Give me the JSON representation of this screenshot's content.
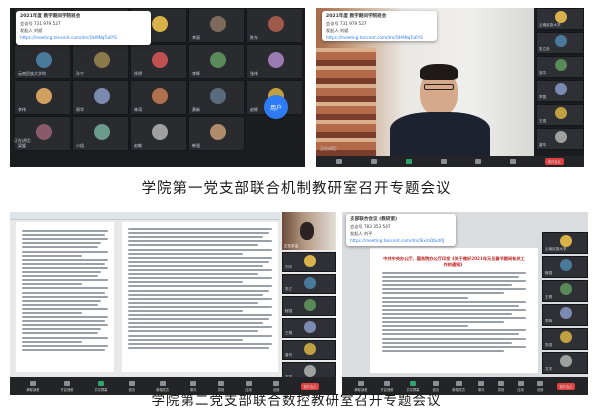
{
  "captions": {
    "top": "学院第一党支部联合机制教研室召开专题会议",
    "bottom": "学院第二党支部联合数控教研室召开专题会议"
  },
  "colors": {
    "dark_bg": "#1b1c1f",
    "toolbar": "#232428",
    "leave_red": "#e04040",
    "accent_blue": "#2d7cf6",
    "purple": "#5b6be0"
  },
  "meetings": {
    "tl": {
      "popup": {
        "title": "2021年度 教学期间学院班会",
        "line1": "会议号 731 979 527",
        "line2": "发起人 刘斌",
        "line3": "https://meeting.tencent.com/dm/OH9NqTu6YS"
      },
      "tiles": [
        {
          "name": "王海"
        },
        {
          "name": "赵强讲生"
        },
        {
          "name": "刘洪"
        },
        {
          "name": "李丽"
        },
        {
          "name": "陈东"
        },
        {
          "name": "云南民族大学的"
        },
        {
          "name": "孙宁"
        },
        {
          "name": "徐明"
        },
        {
          "name": "李辉"
        },
        {
          "name": "张伟"
        },
        {
          "name": "李伟"
        },
        {
          "name": "周华"
        },
        {
          "name": "林涛"
        },
        {
          "name": "黄新"
        },
        {
          "name": "赵辉"
        },
        {
          "name": "梁媛"
        },
        {
          "name": "小组"
        },
        {
          "name": "赵敏"
        },
        {
          "name": "韩强"
        },
        {
          "name": "小程序用户"
        }
      ],
      "avatar_user_label": "用户",
      "speaking_label": "正在讲话:"
    },
    "tr": {
      "popup": {
        "title": "2021年度 教学期间学院班会",
        "line1": "会议号 731 979 527",
        "line2": "发起人 刘斌",
        "line3": "https://meeting.tencent.com/dm/OH9NqTu6YS"
      },
      "side": [
        {
          "name": "云南民族大学"
        },
        {
          "name": "张立忠"
        },
        {
          "name": "邹平"
        },
        {
          "name": "李国"
        },
        {
          "name": "王强"
        },
        {
          "name": "曾华"
        }
      ],
      "speaking_label": "正在讲话:",
      "leave_label": "离开会议"
    },
    "bl": {
      "status_label": "正在讲话",
      "side": [
        {
          "name": "刘平"
        },
        {
          "name": "张江"
        },
        {
          "name": "程强"
        },
        {
          "name": "王刚"
        },
        {
          "name": "曾玲"
        },
        {
          "name": "文宇"
        }
      ],
      "leave_label": "离开会议",
      "toolbar": [
        "解除静音",
        "开启视频",
        "共享屏幕",
        "邀请",
        "管理成员",
        "聊天",
        "录制",
        "应用",
        "设置"
      ]
    },
    "br": {
      "popup": {
        "title": "支部联合会议 (教研室)",
        "line1": "会议号 783 353 547",
        "line2": "发起人 刘平",
        "line3": "https://meeting.tencent.com/dm/SlxmQ6ut0J"
      },
      "doc_title": "中共中央办公厅、国务院办公厅印发《关于做好2021年元旦春节期间有关工作的通知》",
      "side": [
        {
          "name": "云南民族大学"
        },
        {
          "name": "程强"
        },
        {
          "name": "王刚"
        },
        {
          "name": "李辉"
        },
        {
          "name": "张强"
        },
        {
          "name": "文宇"
        }
      ],
      "leave_label": "离开会议",
      "toolbar": [
        "解除静音",
        "开启视频",
        "共享屏幕",
        "邀请",
        "管理成员",
        "聊天",
        "录制",
        "应用",
        "设置"
      ]
    }
  }
}
